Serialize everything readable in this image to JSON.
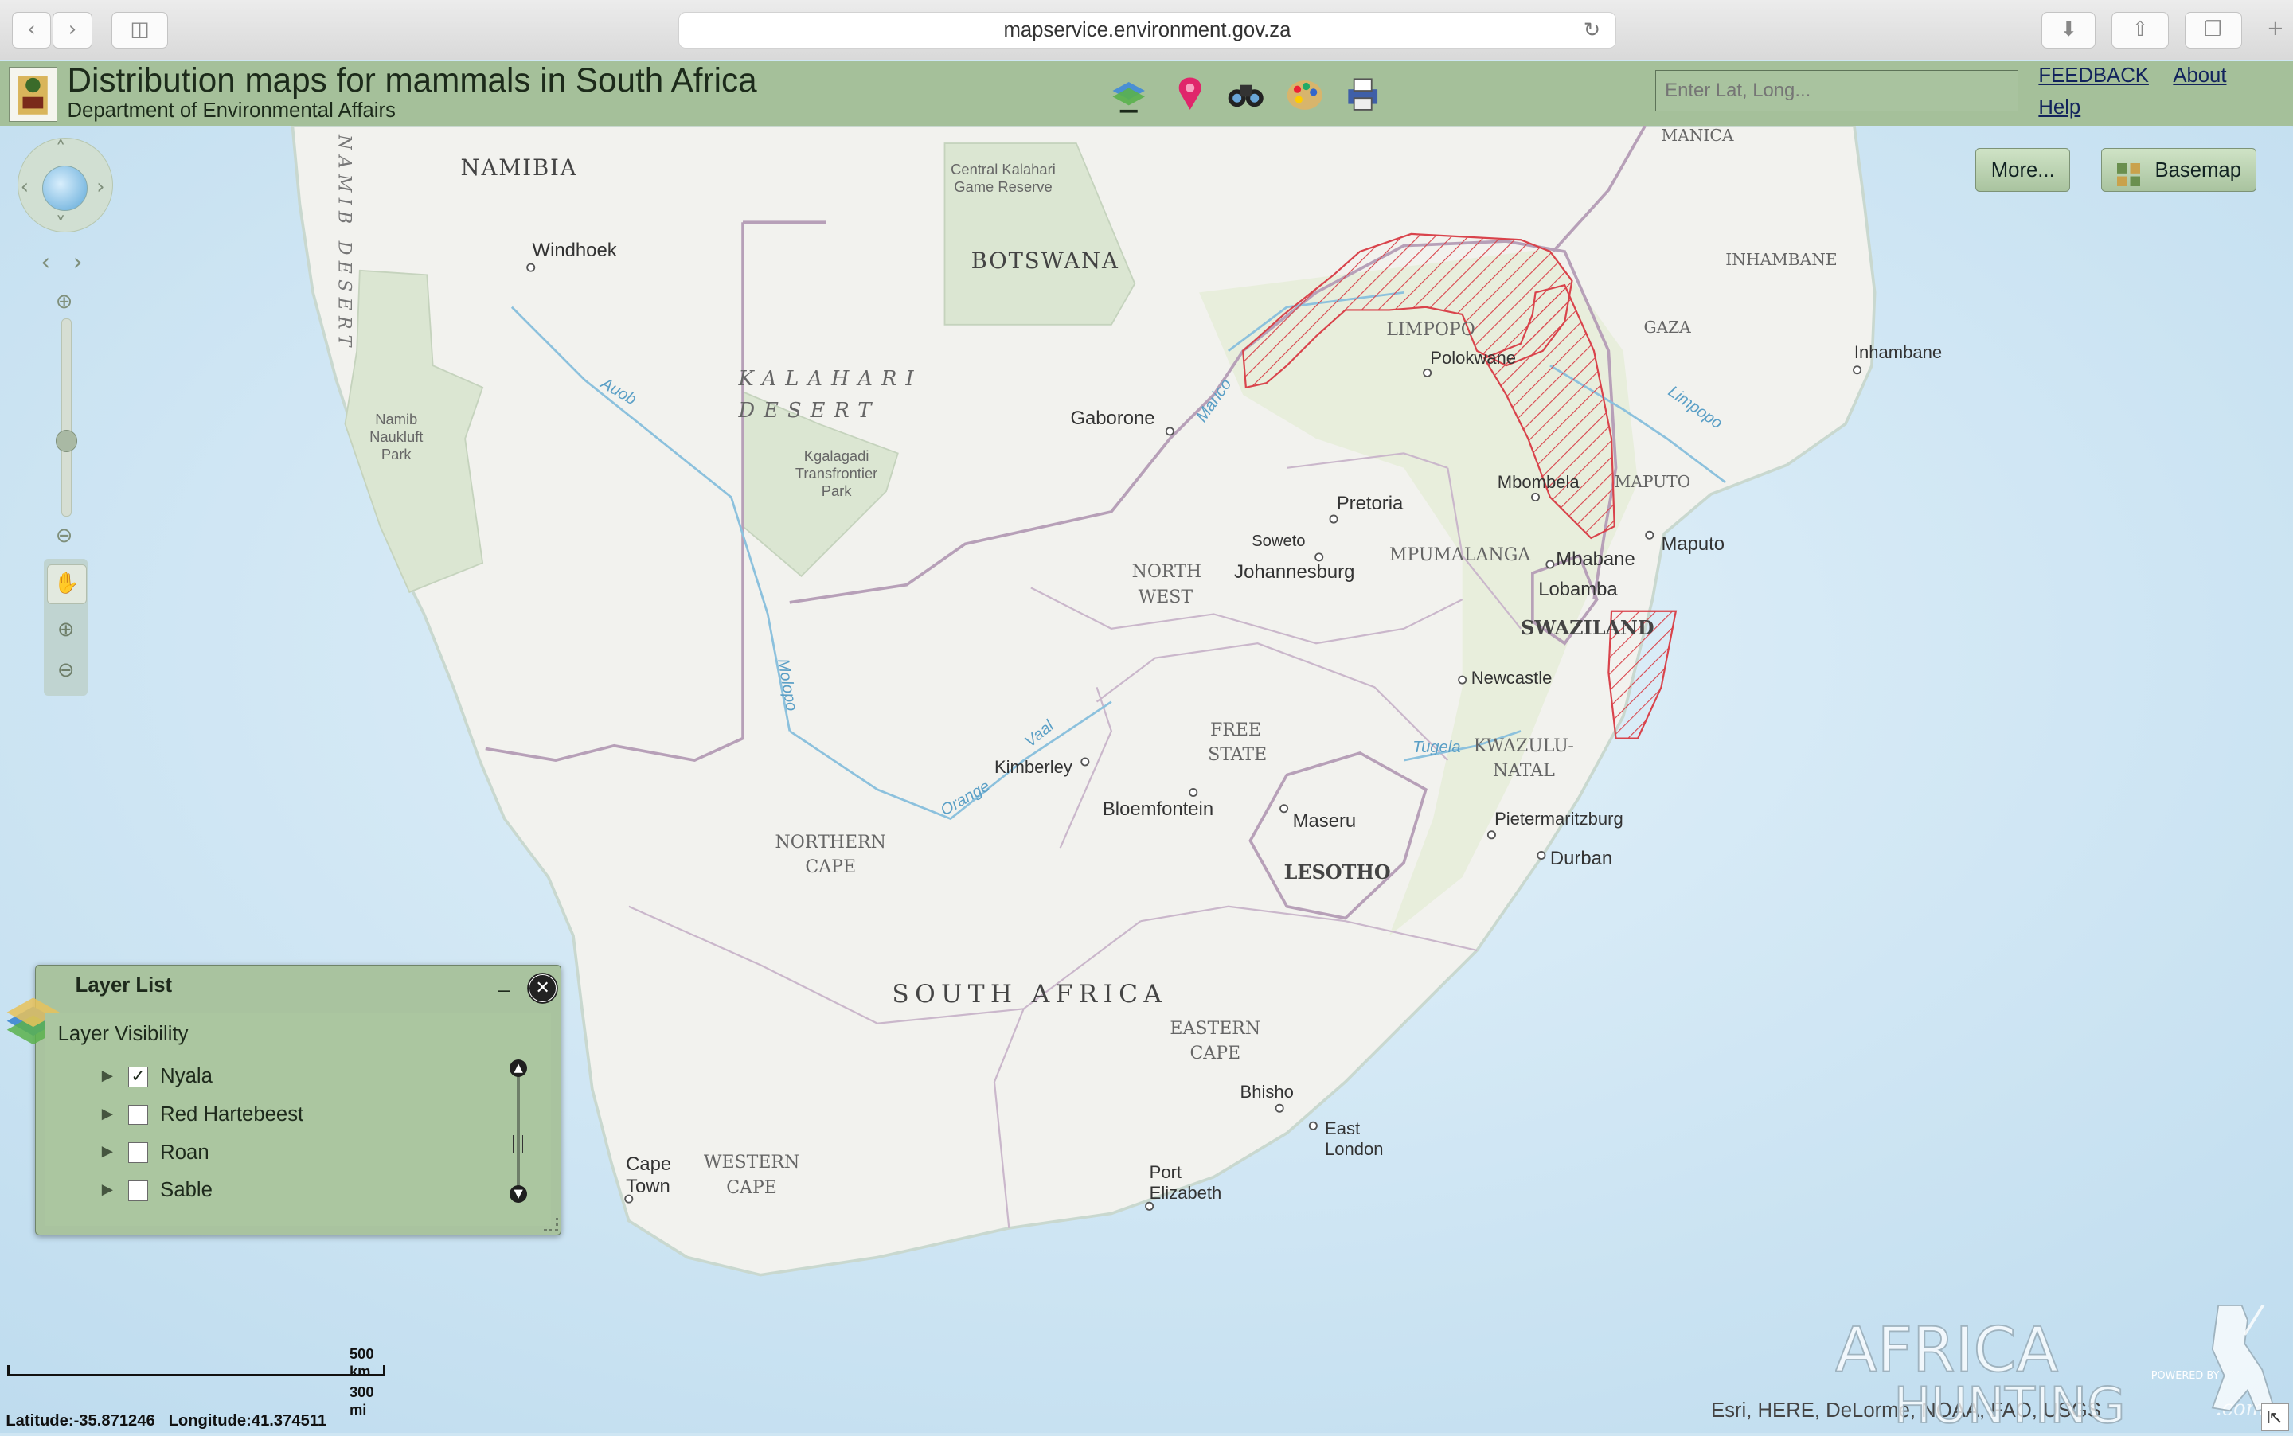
{
  "browser": {
    "url": "mapservice.environment.gov.za"
  },
  "header": {
    "title": "Distribution maps for mammals in South Africa",
    "subtitle": "Department of Environmental Affairs",
    "search_placeholder": "Enter Lat, Long...",
    "links": {
      "feedback": "FEEDBACK",
      "about": "About",
      "help": "Help"
    }
  },
  "toolbar_icons": [
    "layers-icon",
    "pin-icon",
    "binoculars-icon",
    "palette-icon",
    "print-icon"
  ],
  "map_buttons": {
    "more": "More...",
    "basemap": "Basemap"
  },
  "map_labels": {
    "countries": [
      "NAMIBIA",
      "BOTSWANA",
      "SOUTH AFRICA",
      "LESOTHO",
      "SWAZILAND"
    ],
    "regions": [
      "LIMPOPO",
      "MPUMALANGA",
      "NORTH WEST",
      "FREE STATE",
      "KWAZULU-NATAL",
      "NORTHERN CAPE",
      "EASTERN CAPE",
      "WESTERN CAPE",
      "MAPUTO",
      "GAZA",
      "INHAMBANE",
      "MANICA"
    ],
    "cities": [
      "Windhoek",
      "Gaborone",
      "Polokwane",
      "Pretoria",
      "Johannesburg",
      "Soweto",
      "Mbombela",
      "Mbabane",
      "Lobamba",
      "Maputo",
      "Inhambane",
      "Newcastle",
      "Kimberley",
      "Bloemfontein",
      "Maseru",
      "Pietermaritzburg",
      "Durban",
      "Bhisho",
      "East London",
      "Port Elizabeth",
      "Cape Town"
    ],
    "features": [
      "KALAHARI DESERT",
      "NAMIB DESERT",
      "Namib Naukluft Park",
      "Central Kalahari Game Reserve",
      "Kgalagadi Transfrontier Park"
    ],
    "rivers": [
      "Auob",
      "Molopo",
      "Orange",
      "Vaal",
      "Marico",
      "Limpopo",
      "Tugela"
    ]
  },
  "layer_list": {
    "title": "Layer List",
    "minimize": "_",
    "section": "Layer Visibility",
    "layers": [
      {
        "name": "Nyala",
        "checked": true
      },
      {
        "name": "Red Hartebeest",
        "checked": false
      },
      {
        "name": "Roan",
        "checked": false
      },
      {
        "name": "Sable",
        "checked": false
      }
    ]
  },
  "scale": {
    "km": "500 km",
    "mi": "300 mi"
  },
  "coordinates": {
    "lat_label": "Latitude:",
    "lat": "-35.871246",
    "lon_label": "Longitude:",
    "lon": "41.374511"
  },
  "attribution": "Esri, HERE, DeLorme, NOAA, FAO, USGS",
  "watermark": {
    "line1": "AFRICA",
    "line2": "HUNTING",
    "suffix": ".com",
    "powered": "POWERED BY"
  },
  "colors": {
    "header": "#a5c09a",
    "range_hatch": "#d9434b",
    "land": "#f2f2ee",
    "ocean": "#cfe6f3"
  }
}
